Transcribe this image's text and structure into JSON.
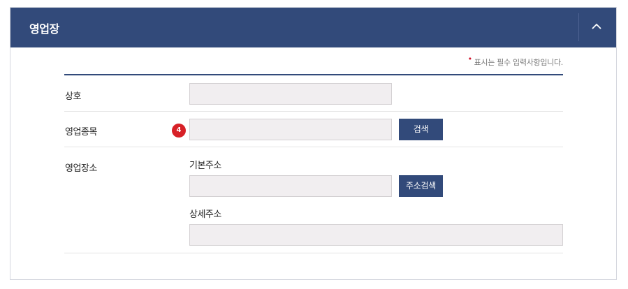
{
  "panel": {
    "title": "영업장",
    "header_color": "#324a7a",
    "collapse_icon": "chevron-up-icon"
  },
  "form": {
    "required_note": "표시는 필수 입력사항입니다.",
    "required_marker": "•",
    "trade_name": {
      "label": "상호",
      "value": ""
    },
    "business_type": {
      "label": "영업종목",
      "value": "",
      "step_badge": "4",
      "search_button": "검색"
    },
    "business_location": {
      "label": "영업장소",
      "basic_address": {
        "label": "기본주소",
        "value": "",
        "search_button": "주소검색"
      },
      "detail_address": {
        "label": "상세주소",
        "value": ""
      }
    }
  }
}
